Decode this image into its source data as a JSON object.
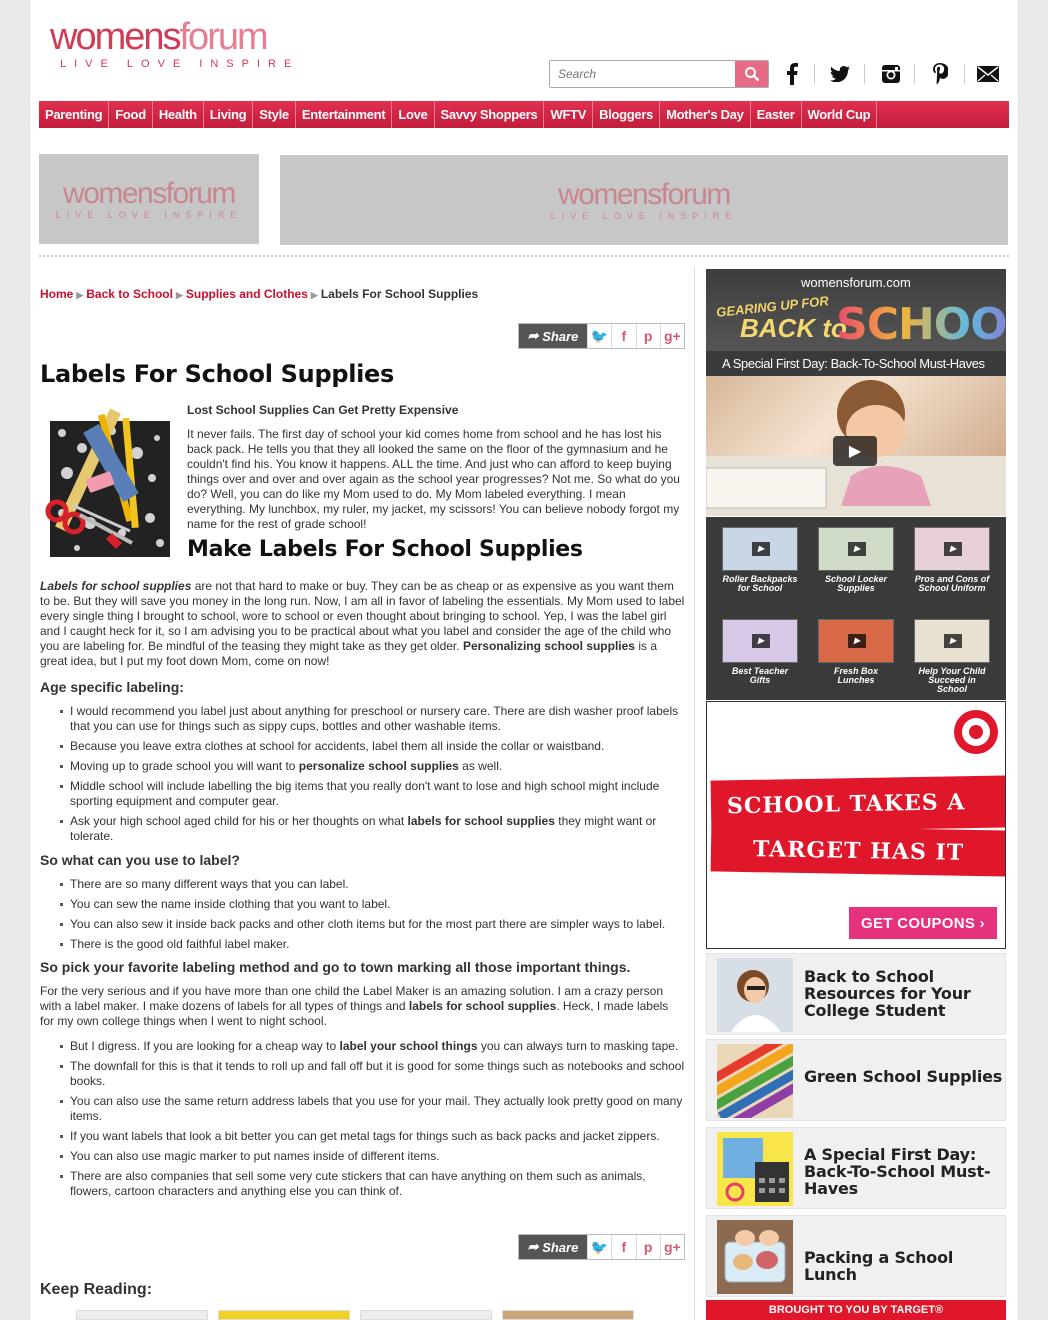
{
  "header": {
    "logo_main_1": "womens",
    "logo_main_2": "forum",
    "logo_tag": "LIVE   LOVE   INSPIRE",
    "search_placeholder": "Search",
    "social": [
      {
        "icon": "facebook-icon",
        "glyph": "f"
      },
      {
        "icon": "twitter-icon",
        "glyph": "🐦"
      },
      {
        "icon": "instagram-icon",
        "glyph": "◙"
      },
      {
        "icon": "pinterest-icon",
        "glyph": "𝒫"
      },
      {
        "icon": "email-icon",
        "glyph": "✉"
      }
    ]
  },
  "nav": [
    "Parenting",
    "Food",
    "Health",
    "Living",
    "Style",
    "Entertainment",
    "Love",
    "Savvy Shoppers",
    "WFTV",
    "Bloggers",
    "Mother's Day",
    "Easter",
    "World Cup"
  ],
  "ads": {
    "logo_1": "womensforum",
    "logo_tag": "LIVE  LOVE  INSPIRE"
  },
  "breadcrumb": [
    "Home",
    "Back to School",
    "Supplies and Clothes",
    "Labels For School Supplies"
  ],
  "share": {
    "label": "Share",
    "icons": [
      "🐦",
      "f",
      "p",
      "g+"
    ]
  },
  "article": {
    "title": "Labels For School Supplies",
    "intro_heading": "Lost School Supplies Can Get Pretty Expensive",
    "intro_text": "It never fails.  The first day of school your kid comes home from school and he has lost his back pack.  He tells you that they all looked the same on the floor of the gymnasium and he couldn't find his.  You know it happens.  ALL the time.  And just who can afford to keep buying things over and over and over again as the school year progresses?  Not me.  So what do you do?  Well, you can do like my Mom used to do.  My Mom labeled everything.  I mean everything.  My lunchbox, my ruler, my jacket, my scissors!  You can believe nobody forgot my name for the rest of grade school!",
    "h2": "Make Labels For School Supplies",
    "p1_lead": "Labels for school supplies",
    "p1_text": " are not that hard to make or buy.  They can be as cheap or as expensive as you want them to be.  But they will save you money in the long run.  Now, I am all in favor of labeling the essentials.  My Mom used to label every single thing I brought to school, wore to school or even thought about bringing to school.  Yep, I was the label girl and I caught heck for it, so I am advising you to be practical about what you label and consider the age of the child who you are labeling for.  Be mindful of the teasing they might take as they get older.  ",
    "p1_bold2": "Personalizing school supplies",
    "p1_end": " is a great idea, but I put my foot down Mom, come on now!",
    "age_heading": "Age specific labeling:",
    "age_items": [
      {
        "a": "I would recommend you label just about anything for preschool or nursery care.  There are dish washer proof labels that you can use for things such as sippy cups, bottles and other washable items.",
        "b": "",
        "c": ""
      },
      {
        "a": "Because you leave extra clothes at school for accidents, label them all inside the collar or waistband.",
        "b": "",
        "c": ""
      },
      {
        "a": "Moving up to grade school you will want to ",
        "b": "personalize school supplies",
        "c": " as well."
      },
      {
        "a": "Middle school will include labelling the big items that you really don't want to lose and high school might include sporting equipment and computer gear.",
        "b": "",
        "c": ""
      },
      {
        "a": "Ask your high school aged child for his or her thoughts on what ",
        "b": "labels for school supplies",
        "c": " they might want or tolerate."
      }
    ],
    "what_heading": "So what can you use to label?",
    "what_items": [
      "There are so many different ways that you can label.",
      "You can sew the name inside clothing that you want to label.",
      "You can also sew it inside back packs and other cloth items but for the most part there are simpler ways to label.",
      "There is the good old faithful label maker."
    ],
    "pick_heading": "So pick your favorite labeling method and go to town marking all those important things.",
    "p2_text": "For the very serious and if you have more than one child the Label Maker is an amazing solution.  I am a crazy person with a label maker.  I make dozens of labels for all types of things and ",
    "p2_bold": "labels for school supplies",
    "p2_end": ".  Heck, I made labels for my own college things when I went to night school.",
    "final_items": [
      {
        "a": "But I digress.  If you are looking for a cheap way to ",
        "b": "label your school things",
        "c": " you can always turn to masking tape."
      },
      {
        "a": "The downfall for this is that it tends to roll up and fall off but it is good for some things such as notebooks and school books.",
        "b": "",
        "c": ""
      },
      {
        "a": "You can also use the same return address labels that you use for your mail. They actually look pretty good on many items.",
        "b": "",
        "c": ""
      },
      {
        "a": "If you want labels that look a bit better you can get metal tags for things such as back packs and jacket zippers.",
        "b": "",
        "c": ""
      },
      {
        "a": "You can also use magic marker to put names inside of different items.",
        "b": "",
        "c": ""
      },
      {
        "a": "There are also companies that sell some very cute stickers that can have anything on them such as animals, flowers, cartoon characters and anything else you can think of.",
        "b": "",
        "c": ""
      }
    ],
    "keep_reading": "Keep Reading:"
  },
  "sidebar": {
    "bts_site": "womensforum.com",
    "bts_gearing": "GEARING UP FOR",
    "bts_back": "BACK to",
    "bts_school": "SCHOOL",
    "bts_caption": "A Special First Day: Back-To-School Must-Haves",
    "videos": [
      "Roller Backpacks for School",
      "School Locker Supplies",
      "Pros and Cons of School Uniform",
      "Best Teacher Gifts",
      "Fresh Box Lunches",
      "Help Your Child Succeed in School"
    ],
    "target_line1": "SCHOOL TAKES A LOT.",
    "target_line2": "TARGET HAS IT ALL.",
    "target_cta": "GET COUPONS ›",
    "related": [
      "Back to School Resources for Your College Student",
      "Green School Supplies",
      "A Special First Day: Back-To-School Must-Haves",
      "Packing a School Lunch"
    ],
    "brought": "BROUGHT TO YOU BY TARGET®"
  },
  "colors": {
    "brand": "#c8102e",
    "nav": "#d7264a",
    "target_red": "#e0162b"
  }
}
